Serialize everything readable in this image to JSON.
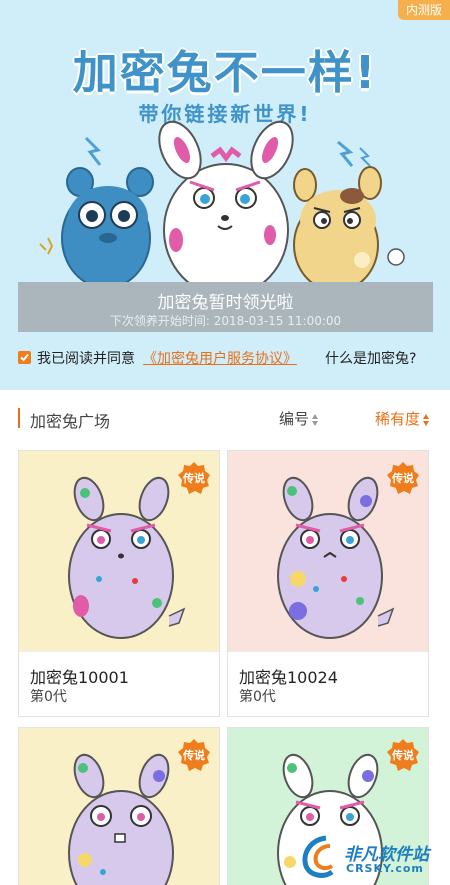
{
  "hero": {
    "beta_badge": "内测版",
    "title": "加密兔不一样!",
    "subtitle": "带你链接新世界!",
    "claim_title": "加密兔暂时领光啦",
    "claim_time": "下次领养开始时间: 2018-03-15 11:00:00",
    "agree_text": "我已阅读并同意",
    "agree_link": "《加密兔用户服务协议》",
    "what_link": "什么是加密兔?",
    "accent_color": "#e8711a"
  },
  "square": {
    "title": "加密兔广场",
    "sort_number": "编号",
    "sort_rarity": "稀有度"
  },
  "cards": [
    {
      "name": "加密兔10001",
      "generation": "第0代",
      "badge": "传说",
      "bg": "#faf0c8"
    },
    {
      "name": "加密兔10024",
      "generation": "第0代",
      "badge": "传说",
      "bg": "#fae3dc"
    },
    {
      "badge": "传说",
      "bg": "#faf0c8"
    },
    {
      "badge": "传说",
      "bg": "#d3f3d8"
    }
  ],
  "watermark": {
    "line1": "非凡软件站",
    "line2": "CRSKY.com"
  }
}
